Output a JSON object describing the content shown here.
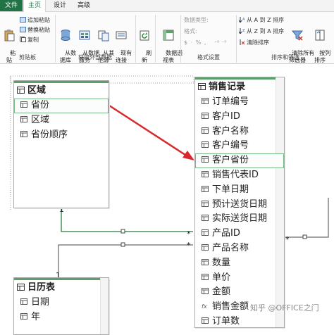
{
  "tabs": {
    "file": "文件",
    "home": "主页",
    "design": "设计",
    "advanced": "高级"
  },
  "clipboard": {
    "paste": "粘\n贴",
    "append_paste": "追加粘贴",
    "replace_paste": "替换粘贴",
    "copy": "复制",
    "label": "剪贴板"
  },
  "external": {
    "from_db": "从数\n据库",
    "from_service": "从数据\n服务",
    "from_other": "从其\n他源",
    "existing": "现有\n连接",
    "label": "获取外部数据"
  },
  "refresh": "刷\n新",
  "pivot": "数据透\n视表",
  "format": {
    "data_type": "数据类型:",
    "format": "格式:",
    "symbols": "$ · % ,",
    "decimals": "⁺⁰ ⁻⁰",
    "label": "格式设置"
  },
  "sort": {
    "asc": "从 A 到 Z 排序",
    "desc": "从 Z 到 A 排序",
    "clear_sort": "清除排序",
    "clear_filters": "清除所有\n筛选器",
    "by_column": "按列\n排序",
    "label": "排序和筛选"
  },
  "tables": {
    "region": {
      "title": "区域",
      "fields": [
        "省份",
        "区域",
        "省份顺序"
      ]
    },
    "sales": {
      "title": "销售记录",
      "fields": [
        "订单编号",
        "客户ID",
        "客户名称",
        "客户编号",
        "客户省份",
        "销售代表ID",
        "下单日期",
        "预计送货日期",
        "实际送货日期",
        "产品ID",
        "产品名称",
        "数量",
        "单价",
        "金额",
        "销售金额",
        "订单数"
      ]
    },
    "calendar": {
      "title": "日历表",
      "fields": [
        "日期",
        "年"
      ]
    }
  },
  "rel": {
    "one": "1",
    "many": "*"
  },
  "watermark": "知乎 @OFFICE之门",
  "colors": {
    "accent": "#217346",
    "header_bar": "#5a9e68",
    "relationship_arrow": "#d9282b"
  }
}
